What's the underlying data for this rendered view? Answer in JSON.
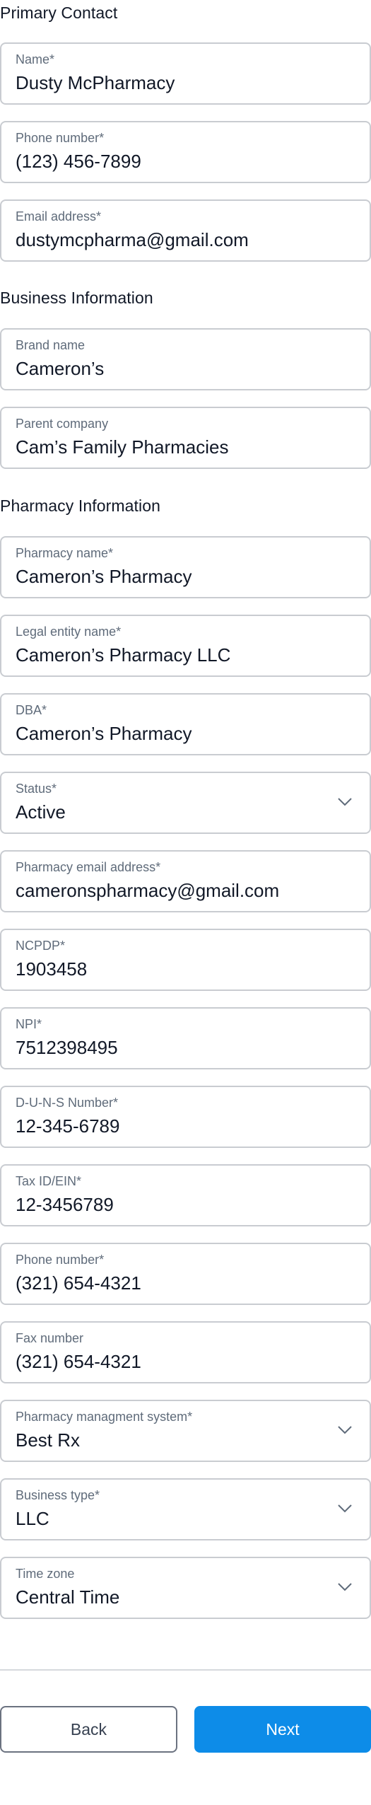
{
  "sections": {
    "primary_contact": "Primary Contact",
    "business_information": "Business Information",
    "pharmacy_information": "Pharmacy Information"
  },
  "primary_contact": {
    "name": {
      "label": "Name*",
      "value": "Dusty McPharmacy"
    },
    "phone": {
      "label": "Phone number*",
      "value": "(123) 456-7899"
    },
    "email": {
      "label": "Email address*",
      "value": "dustymcpharma@gmail.com"
    }
  },
  "business_information": {
    "brand_name": {
      "label": "Brand name",
      "value": "Cameron’s"
    },
    "parent_company": {
      "label": "Parent company",
      "value": "Cam’s Family Pharmacies"
    }
  },
  "pharmacy_information": {
    "pharmacy_name": {
      "label": "Pharmacy name*",
      "value": "Cameron’s Pharmacy"
    },
    "legal_entity_name": {
      "label": "Legal entity name*",
      "value": "Cameron’s Pharmacy LLC"
    },
    "dba": {
      "label": "DBA*",
      "value": "Cameron’s Pharmacy"
    },
    "status": {
      "label": "Status*",
      "value": "Active"
    },
    "pharmacy_email": {
      "label": "Pharmacy email address*",
      "value": "cameronspharmacy@gmail.com"
    },
    "ncpdp": {
      "label": "NCPDP*",
      "value": "1903458"
    },
    "npi": {
      "label": "NPI*",
      "value": "7512398495"
    },
    "duns": {
      "label": "D-U-N-S Number*",
      "value": "12-345-6789"
    },
    "tax_id": {
      "label": "Tax ID/EIN*",
      "value": "12-3456789"
    },
    "phone": {
      "label": "Phone number*",
      "value": "(321) 654-4321"
    },
    "fax": {
      "label": "Fax number",
      "value": "(321) 654-4321"
    },
    "management_system": {
      "label": "Pharmacy managment system*",
      "value": "Best Rx"
    },
    "business_type": {
      "label": "Business type*",
      "value": "LLC"
    },
    "time_zone": {
      "label": "Time zone",
      "value": "Central Time"
    }
  },
  "buttons": {
    "back": "Back",
    "next": "Next"
  },
  "icons": {
    "dropdown": "chevron-down-icon"
  },
  "colors": {
    "primary": "#0d8ce8",
    "border": "#c9ccd1",
    "label": "#5f6b7a"
  }
}
